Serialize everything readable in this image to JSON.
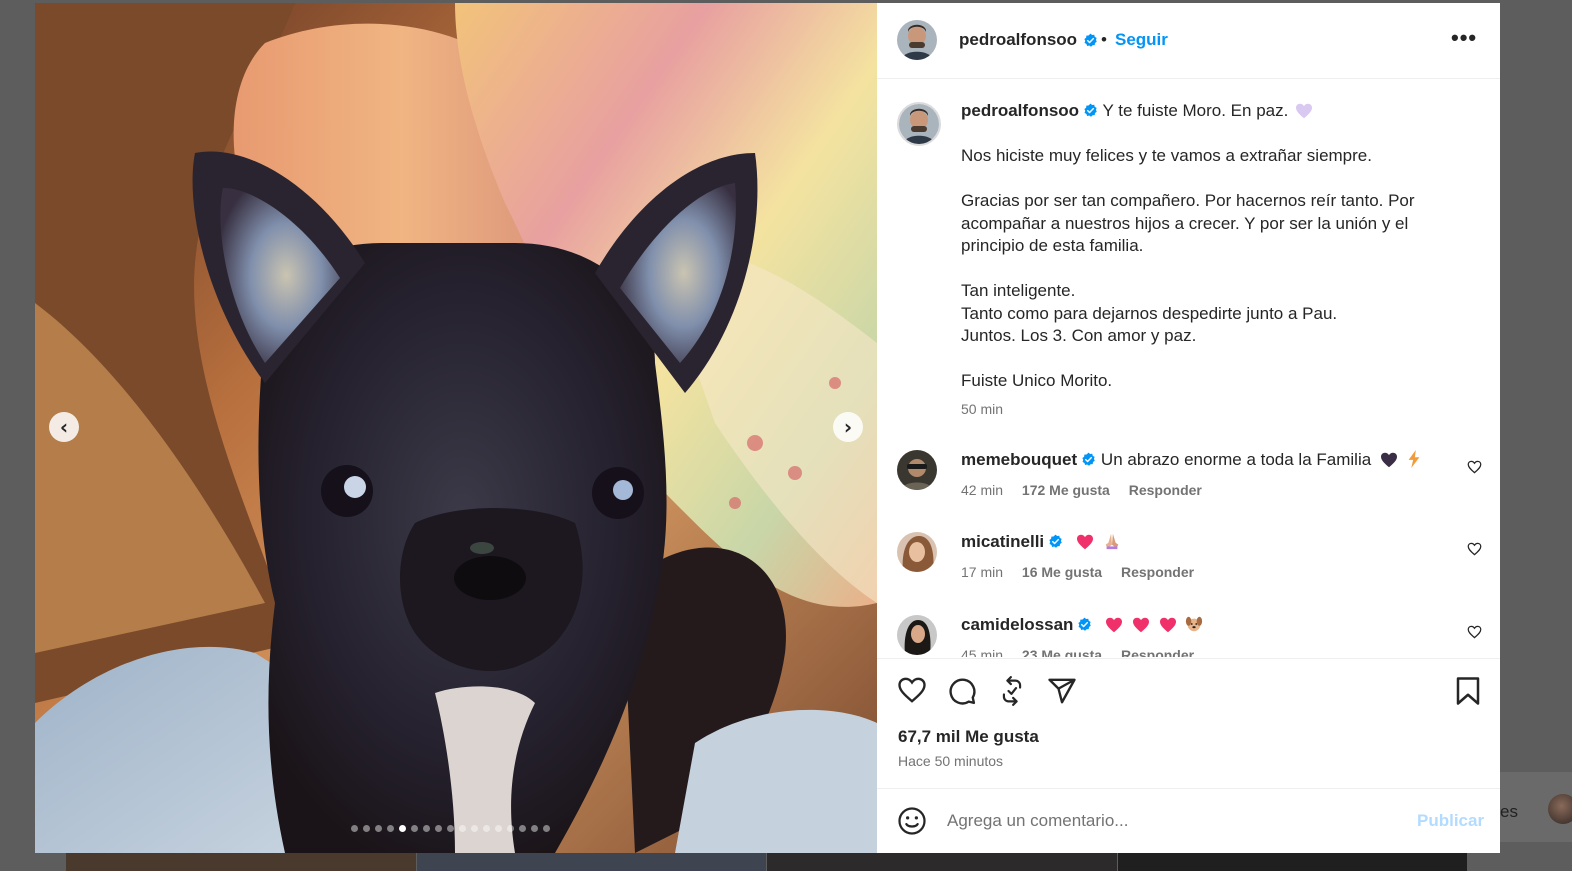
{
  "post": {
    "author": "pedroalfonsoo",
    "follow_label": "Seguir",
    "separator": "•",
    "caption_first": "Y te fuiste Moro. En paz.",
    "caption_lines": [
      "Nos hiciste muy felices y te vamos a extrañar siempre.",
      "",
      "Gracias por ser tan compañero. Por hacernos reír tanto. Por",
      "acompañar a nuestros hijos a crecer. Y por ser la unión y el",
      "principio de esta familia.",
      "",
      "Tan inteligente.",
      "Tanto como para dejarnos despedirte junto a Pau.",
      "Juntos. Los 3. Con amor y paz.",
      "",
      "Fuiste Unico Morito."
    ],
    "caption_time": "50 min",
    "likes": "67,7 mil Me gusta",
    "posted_ago": "Hace 50 minutos",
    "carousel_count": 17,
    "carousel_active": 5
  },
  "comments": [
    {
      "user": "memebouquet",
      "text": "Un abrazo enorme a toda la Familia",
      "emojis": [
        "black-heart",
        "lightning"
      ],
      "time": "42 min",
      "likes": "172 Me gusta",
      "reply": "Responder"
    },
    {
      "user": "micatinelli",
      "text": "",
      "emojis": [
        "red-heart",
        "praying-hands"
      ],
      "time": "17 min",
      "likes": "16 Me gusta",
      "reply": "Responder"
    },
    {
      "user": "camidelossan",
      "text": "",
      "emojis": [
        "red-heart",
        "red-heart",
        "red-heart",
        "dog-face"
      ],
      "time": "45 min",
      "likes": "23 Me gusta",
      "reply": "Responder"
    }
  ],
  "composer": {
    "placeholder": "Agrega un comentario...",
    "publish_label": "Publicar"
  },
  "background": {
    "side_text": "es"
  },
  "colors": {
    "link_blue": "#0095f6",
    "verified_blue": "#0095f6",
    "publish_disabled": "#b3dbff",
    "muted_text": "#737373"
  }
}
